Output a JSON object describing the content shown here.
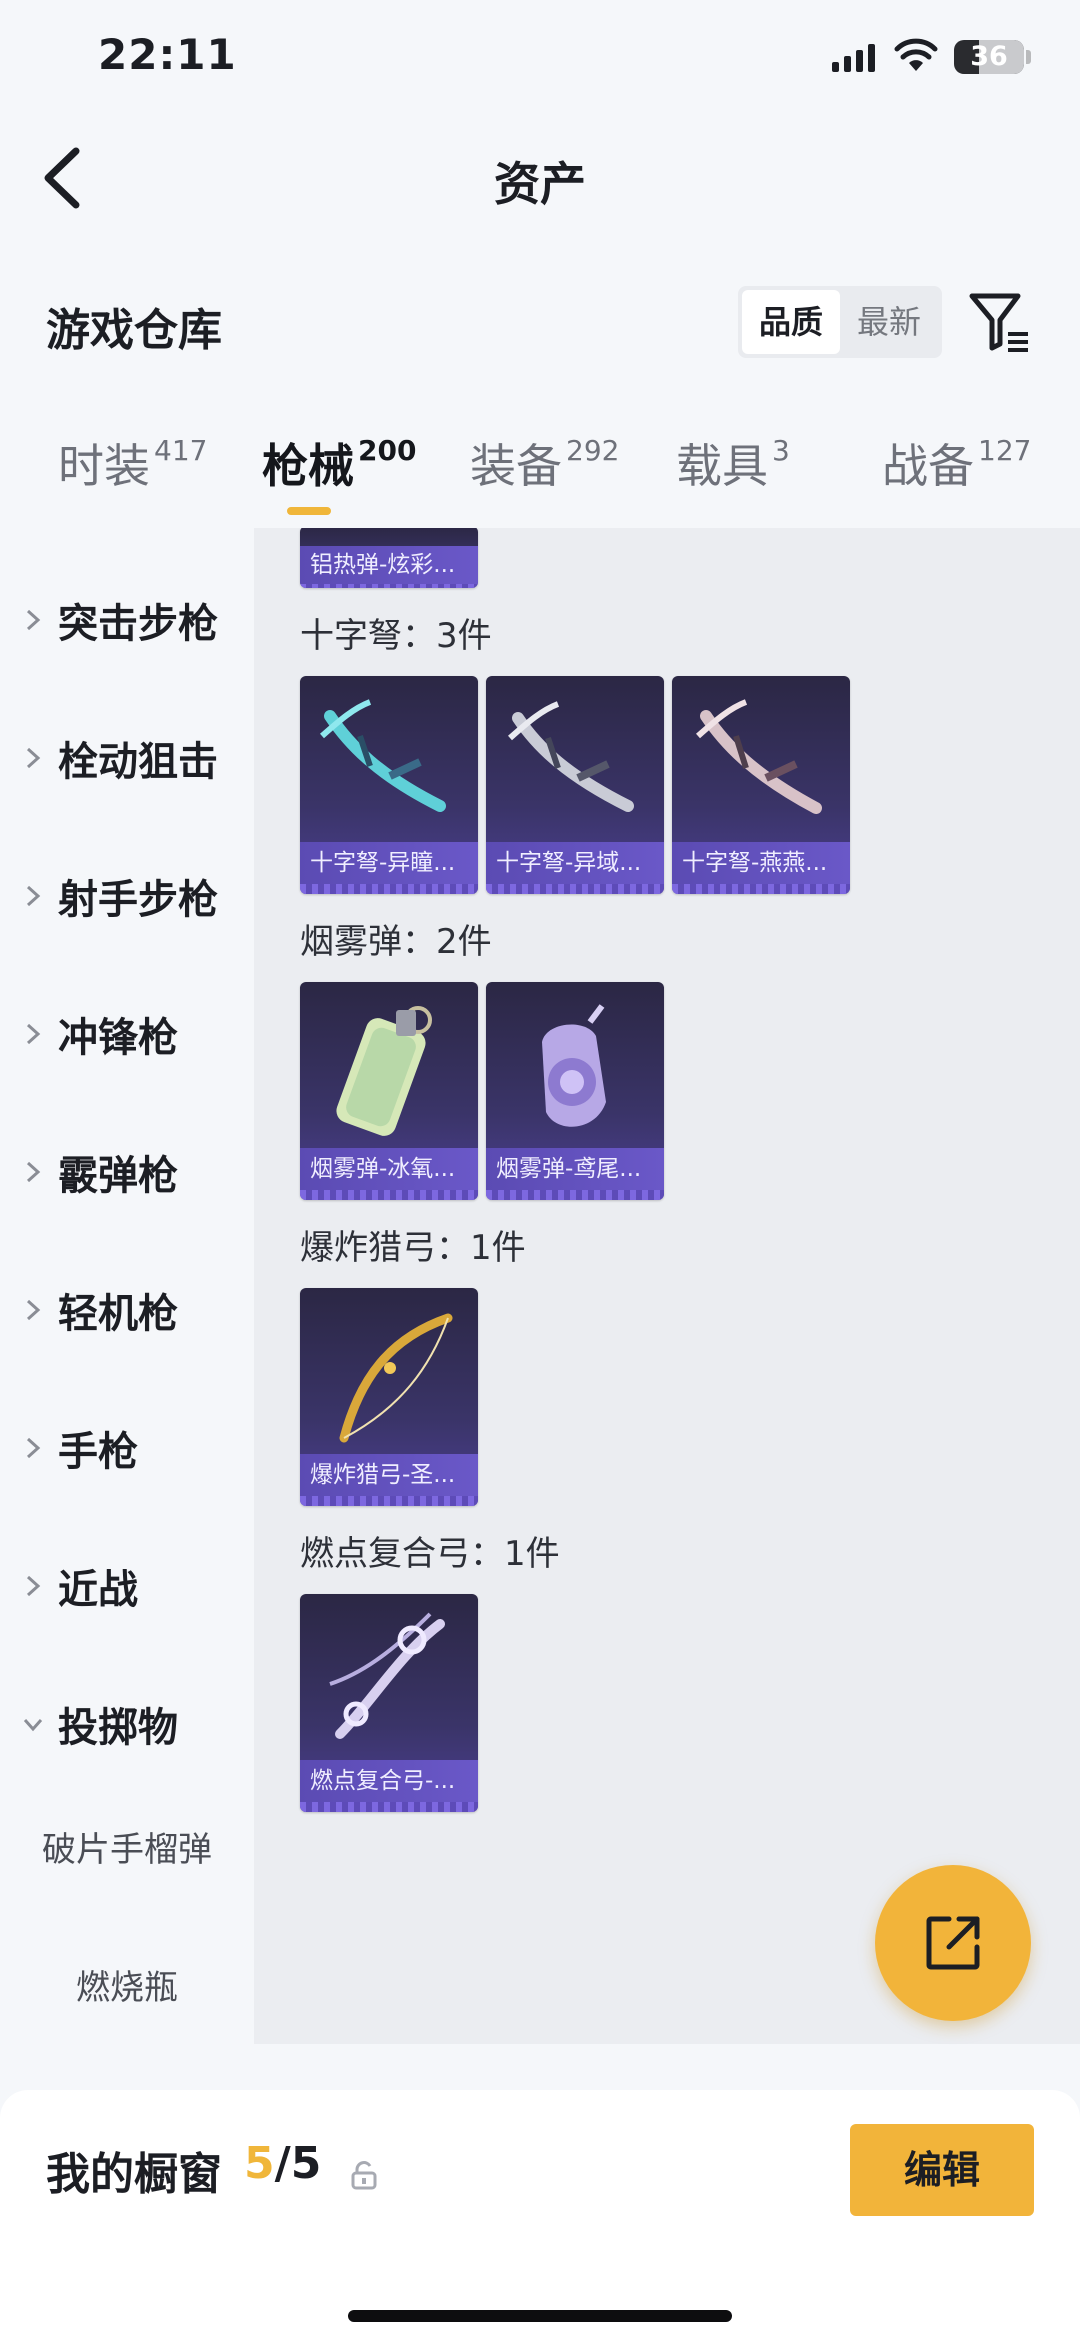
{
  "status_bar": {
    "time": "22:11",
    "battery": "36",
    "battery_level": 0.36
  },
  "nav": {
    "title": "资产"
  },
  "warehouse": {
    "title": "游戏仓库",
    "sort_options": [
      "品质",
      "最新"
    ],
    "active_sort": "品质"
  },
  "tabs": [
    {
      "label": "时装",
      "count": "417"
    },
    {
      "label": "枪械",
      "count": "200",
      "active": true
    },
    {
      "label": "装备",
      "count": "292"
    },
    {
      "label": "载具",
      "count": "3"
    },
    {
      "label": "战备",
      "count": "127"
    }
  ],
  "sidebar": {
    "items": [
      {
        "label": "突击步枪",
        "expanded": false
      },
      {
        "label": "栓动狙击",
        "expanded": false
      },
      {
        "label": "射手步枪",
        "expanded": false
      },
      {
        "label": "冲锋枪",
        "expanded": false
      },
      {
        "label": "霰弹枪",
        "expanded": false
      },
      {
        "label": "轻机枪",
        "expanded": false
      },
      {
        "label": "手枪",
        "expanded": false
      },
      {
        "label": "近战",
        "expanded": false
      },
      {
        "label": "投掷物",
        "expanded": true
      }
    ],
    "subitems": [
      "破片手榴弹",
      "燃烧瓶"
    ]
  },
  "content": {
    "partial_card": "铝热弹-炫彩...",
    "sections": [
      {
        "label": "十字弩：3件",
        "items": [
          "十字弩-异瞳...",
          "十字弩-异域...",
          "十字弩-燕燕..."
        ],
        "art": [
          "crossbow-teal",
          "crossbow-silver",
          "crossbow-rose"
        ]
      },
      {
        "label": "烟雾弹：2件",
        "items": [
          "烟雾弹-冰氧...",
          "烟雾弹-鸢尾..."
        ],
        "art": [
          "smoke-mint",
          "smoke-iris"
        ]
      },
      {
        "label": "爆炸猎弓：1件",
        "items": [
          "爆炸猎弓-圣..."
        ],
        "art": [
          "bow-gold"
        ]
      },
      {
        "label": "燃点复合弓：1件",
        "items": [
          "燃点复合弓-..."
        ],
        "art": [
          "compound-bow-lilac"
        ]
      }
    ]
  },
  "bottom_bar": {
    "title": "我的橱窗",
    "current": "5",
    "total": "/5",
    "edit_label": "编辑"
  },
  "colors": {
    "accent": "#f2b43a",
    "card_purple": "#5b4bb3"
  }
}
